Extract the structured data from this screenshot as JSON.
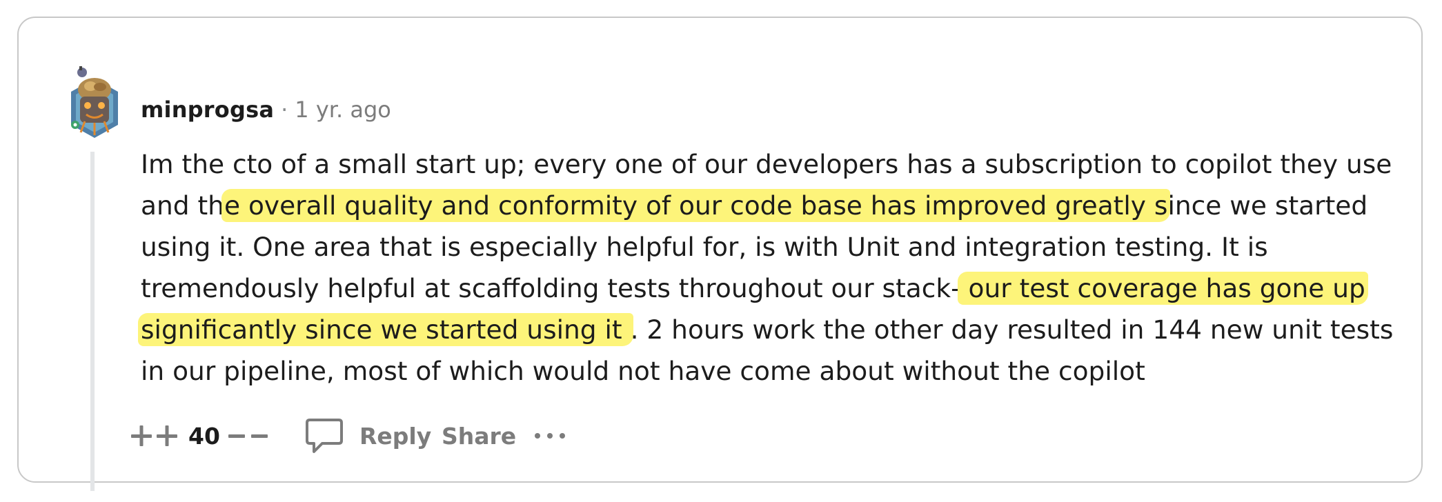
{
  "comment": {
    "username": "minprogsa",
    "separator": "·",
    "timestamp": "1 yr. ago",
    "body_segments": [
      {
        "text": "Im the cto of a small start up; every one of our developers has a subscription to copilot they use and th",
        "highlighted": false
      },
      {
        "text": "e overall quality and conformity of our code base has improved greatly s",
        "highlighted": true
      },
      {
        "text": "ince we started using it. One area that is especially helpful for, is with Unit and integration testing. It is tremendously helpful at scaffolding tests throughout our stack-",
        "highlighted": false
      },
      {
        "text": " our test coverage has gone up significantly since we started using it ",
        "highlighted": true
      },
      {
        "text": ". 2 hours work the other day resulted in 144 new unit tests in our pipeline, most of which would not have come about without the copilot",
        "highlighted": false
      }
    ]
  },
  "actions": {
    "upvote_icon": "upvote-icon",
    "vote_count": "40",
    "downvote_icon": "downvote-icon",
    "reply_icon": "speech-bubble-icon",
    "reply_label": "Reply",
    "share_label": "Share",
    "more_icon": "ellipsis-icon"
  },
  "colors": {
    "highlight": "#fdf47a",
    "username": "#1c1c1c",
    "muted": "#7c7c7c",
    "thread_line": "#e3e5e7",
    "card_border": "#c8c8c8"
  }
}
